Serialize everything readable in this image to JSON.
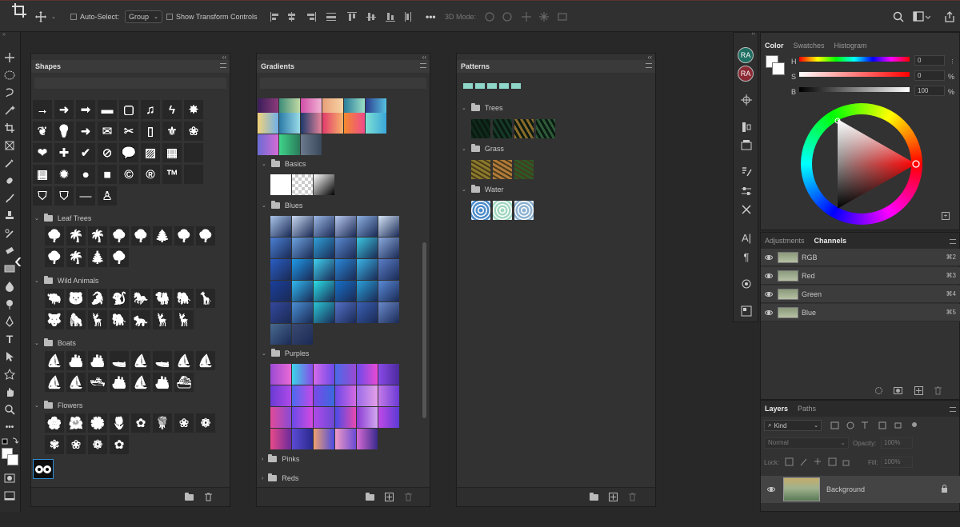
{
  "options_bar": {
    "auto_select_label": "Auto-Select:",
    "auto_select_value": "Group",
    "show_transform_label": "Show Transform Controls",
    "mode_3d_label": "3D Mode:"
  },
  "shapes_panel": {
    "title": "Shapes",
    "top_glyphs": [
      "→",
      "➜",
      "➡",
      "▬",
      "▢",
      "♫",
      "ϟ",
      "✸",
      "❦",
      "💡",
      "➜",
      "✉",
      "✂",
      "▯",
      "⚜",
      "❀",
      "❤",
      "✚",
      "✔",
      "⊘",
      "💬",
      "▨",
      "▦",
      "",
      "▦",
      "✹",
      "●",
      "■",
      "©",
      "®",
      "™",
      "",
      "⛉",
      "⛉",
      "—",
      "♙"
    ],
    "groups": [
      {
        "name": "Leaf Trees",
        "glyphs": [
          "🌳",
          "🌴",
          "🌴",
          "🌳",
          "🌳",
          "🌲",
          "🌳",
          "🌳",
          "🌳",
          "🌴",
          "🎄",
          "🌳"
        ]
      },
      {
        "name": "Wild Animals",
        "glyphs": [
          "🐃",
          "🐻",
          "🐊",
          "🐒",
          "🐎",
          "🐫",
          "🐘",
          "🦒",
          "🐺",
          "🦍",
          "🦌",
          "🐘",
          "🐆",
          "🦌",
          "🦌"
        ]
      },
      {
        "name": "Boats",
        "glyphs": [
          "⛵",
          "🚢",
          "🚢",
          "🚤",
          "⛵",
          "🚤",
          "⛵",
          "⛵",
          "⛵",
          "⛵",
          "🛥",
          "🚢",
          "⛵",
          "🚢",
          "⛴"
        ]
      },
      {
        "name": "Flowers",
        "glyphs": [
          "🌸",
          "🌺",
          "🌼",
          "🌷",
          "✿",
          "🌹",
          "❀",
          "❁",
          "✾",
          "❀",
          "❁",
          "✿"
        ]
      }
    ]
  },
  "gradients_panel": {
    "title": "Gradients",
    "groups": [
      "Basics",
      "Blues",
      "Purples",
      "Pinks",
      "Reds"
    ]
  },
  "patterns_panel": {
    "title": "Patterns",
    "groups": [
      "Trees",
      "Grass",
      "Water"
    ]
  },
  "color_panel": {
    "tabs": [
      "Color",
      "Swatches",
      "Histogram"
    ],
    "h_label": "H",
    "s_label": "S",
    "b_label": "B",
    "h_value": "0",
    "s_value": "0",
    "b_value": "100",
    "unit": "%"
  },
  "channels_panel": {
    "tabs": [
      "Adjustments",
      "Channels"
    ],
    "rows": [
      {
        "name": "RGB",
        "shortcut": "⌘2"
      },
      {
        "name": "Red",
        "shortcut": "⌘3"
      },
      {
        "name": "Green",
        "shortcut": "⌘4"
      },
      {
        "name": "Blue",
        "shortcut": "⌘5"
      }
    ]
  },
  "layers_panel": {
    "tabs": [
      "Layers",
      "Paths"
    ],
    "kind_label": "Kind",
    "blend_mode": "Normal",
    "opacity_label": "Opacity:",
    "opacity_value": "100%",
    "lock_label": "Lock:",
    "fill_label": "Fill:",
    "fill_value": "100%",
    "layer_name": "Background"
  },
  "right_strip": {
    "badges": [
      "RA",
      "RA"
    ]
  },
  "colors": {
    "accent": "#2f8fd8",
    "panel": "#323232",
    "bg": "#282828"
  }
}
